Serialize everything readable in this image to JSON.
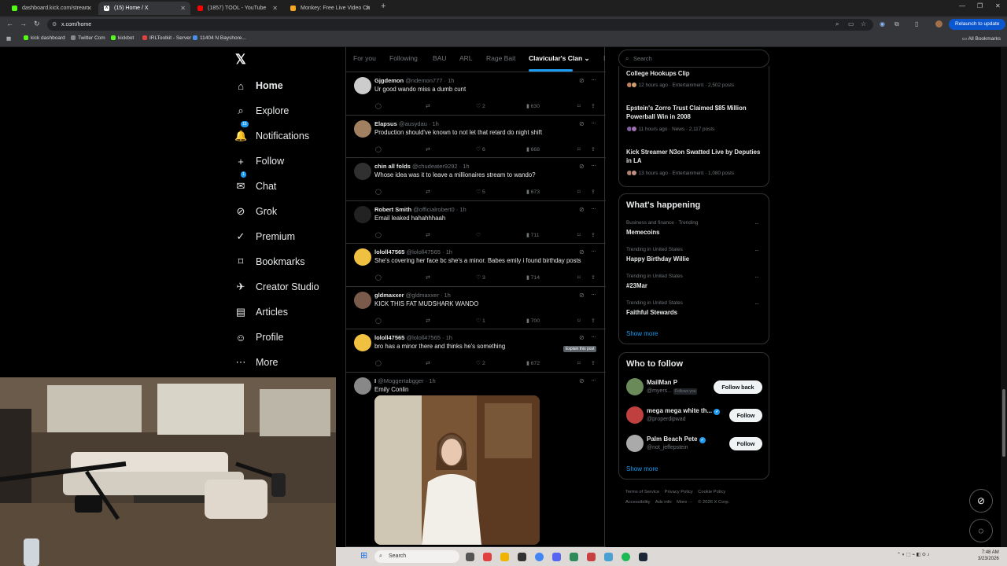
{
  "browser": {
    "tabs": [
      {
        "label": "dashboard.kick.com/stream",
        "color": "#53fc18",
        "active": false
      },
      {
        "label": "(15) Home / X",
        "color": "#000000",
        "active": true
      },
      {
        "label": "(1857) TOOL - YouTube",
        "color": "#ff0000",
        "active": false
      },
      {
        "label": "Monkey: Free Live Video Ch",
        "color": "#f5a623",
        "active": false
      }
    ],
    "url": "x.com/home",
    "relaunch_label": "Relaunch to update",
    "bookmarks": [
      {
        "label": "kick dashboard",
        "color": "#53fc18"
      },
      {
        "label": "Twitter Com",
        "color": "#888888"
      },
      {
        "label": "kickbot",
        "color": "#53fc18"
      },
      {
        "label": "IRLToolkit - Server",
        "color": "#e04040"
      },
      {
        "label": "11404 N Bayshore...",
        "color": "#4a90e2"
      }
    ],
    "all_bookmarks": "All Bookmarks"
  },
  "nav": {
    "logo": "𝕏",
    "items": [
      {
        "label": "Home",
        "icon": "⌂",
        "badge": ""
      },
      {
        "label": "Explore",
        "icon": "⌕",
        "badge": ""
      },
      {
        "label": "Notifications",
        "icon": "🔔",
        "badge": "15"
      },
      {
        "label": "Follow",
        "icon": "+",
        "badge": ""
      },
      {
        "label": "Chat",
        "icon": "✉",
        "badge": "1"
      },
      {
        "label": "Grok",
        "icon": "⊘",
        "badge": ""
      },
      {
        "label": "Premium",
        "icon": "✓",
        "badge": ""
      },
      {
        "label": "Bookmarks",
        "icon": "⌑",
        "badge": ""
      },
      {
        "label": "Creator Studio",
        "icon": "✈",
        "badge": ""
      },
      {
        "label": "Articles",
        "icon": "▤",
        "badge": ""
      },
      {
        "label": "Profile",
        "icon": "☺",
        "badge": ""
      },
      {
        "label": "More",
        "icon": "⋯",
        "badge": ""
      }
    ]
  },
  "feed_tabs": [
    "For you",
    "Following",
    "BAU",
    "ARL",
    "Rage Bait",
    "Clavicular's Clan",
    "I"
  ],
  "tweets": [
    {
      "name": "Gjgdemon",
      "handle": "@ndemon777",
      "time": "1h",
      "text": "Ur good wando miss a dumb cunt",
      "likes": "2",
      "views": "630",
      "avatar_color": "#cccccc"
    },
    {
      "name": "Elapsus",
      "handle": "@ausydau",
      "time": "1h",
      "text": "Production should've known to not let that retard do night shift",
      "likes": "6",
      "views": "668",
      "avatar_color": "#a08060"
    },
    {
      "name": "chin all folds",
      "handle": "@chudeater9292",
      "time": "1h",
      "text": "Whose idea was it to leave a millionaires stream to wando?",
      "likes": "5",
      "views": "673",
      "avatar_color": "#303030"
    },
    {
      "name": "Robert Smith",
      "handle": "@officialrobert0",
      "time": "1h",
      "text": "Email leaked hahahhhaah",
      "likes": "",
      "views": "711",
      "avatar_color": "#222222"
    },
    {
      "name": "lololl47565",
      "handle": "@lololl47565",
      "time": "1h",
      "text": "She's covering her face bc she's a minor. Babes emily i found birthday posts",
      "likes": "3",
      "views": "714",
      "avatar_color": "#f0c040"
    },
    {
      "name": "gldmaxxer",
      "handle": "@gldmaxxer",
      "time": "1h",
      "text": "KICK THIS FAT MUDSHARK WANDO",
      "likes": "1",
      "views": "700",
      "avatar_color": "#7a5a4a"
    },
    {
      "name": "lololl47565",
      "handle": "@lololl47565",
      "time": "1h",
      "text": "bro has a minor there and thinks he's something",
      "likes": "2",
      "views": "672",
      "avatar_color": "#f0c040"
    },
    {
      "name": "I",
      "handle": "@Moggertabgger",
      "time": "1h",
      "text": "Emily Conlin",
      "likes": "",
      "views": "",
      "avatar_color": "#888888"
    }
  ],
  "tooltip": "Explain this post",
  "right": {
    "search_placeholder": "Search",
    "trending_stories": [
      {
        "title": "College Hookups Clip",
        "meta": "12 hours ago · Entertainment · 2,502 posts"
      },
      {
        "title": "Epstein's Zorro Trust Claimed $85 Million Powerball Win in 2008",
        "meta": "11 hours ago · News · 2,117 posts"
      },
      {
        "title": "Kick Streamer N3on Swatted Live by Deputies in LA",
        "meta": "13 hours ago · Entertainment · 1,080 posts"
      }
    ],
    "whats_happening_title": "What's happening",
    "trends": [
      {
        "category": "Business and finance · Trending",
        "name": "Memecoins"
      },
      {
        "category": "Trending in United States",
        "name": "Happy Birthday Willie"
      },
      {
        "category": "Trending in United States",
        "name": "#23Mar"
      },
      {
        "category": "Trending in United States",
        "name": "Faithful Stewards"
      }
    ],
    "show_more": "Show more",
    "who_to_follow_title": "Who to follow",
    "suggestions": [
      {
        "name": "MailMan P",
        "handle": "@myers...",
        "follows_you": "Follows you",
        "verified": false,
        "button": "Follow back",
        "avatar_color": "#6a8a5a"
      },
      {
        "name": "mega mega white th...",
        "handle": "@properdipwad",
        "follows_you": "",
        "verified": true,
        "button": "Follow",
        "avatar_color": "#c04040"
      },
      {
        "name": "Palm Beach Pete",
        "handle": "@not_jeffepstein",
        "follows_you": "",
        "verified": true,
        "button": "Follow",
        "avatar_color": "#aaaaaa"
      }
    ],
    "footer_row1": [
      "Terms of Service",
      "Privacy Policy",
      "Cookie Policy"
    ],
    "footer_row2": [
      "Accessibility",
      "Ads info",
      "More ···",
      "© 2026 X Corp."
    ]
  },
  "taskbar": {
    "search_label": "Search",
    "time": "7:48 AM",
    "date": "3/23/2026"
  }
}
